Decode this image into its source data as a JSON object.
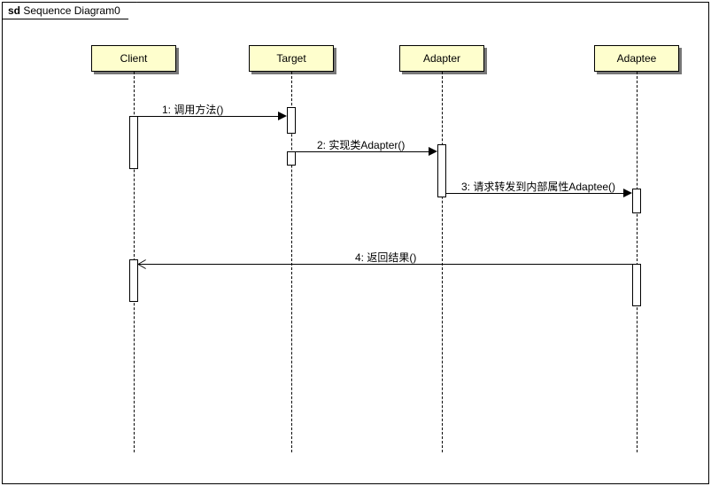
{
  "frame": {
    "prefix": "sd",
    "title": "Sequence Diagram0"
  },
  "participants": {
    "client": "Client",
    "target": "Target",
    "adapter": "Adapter",
    "adaptee": "Adaptee"
  },
  "messages": {
    "m1": "1: 调用方法()",
    "m2": "2: 实现类Adapter()",
    "m3": "3: 请求转发到内部属性Adaptee()",
    "m4": "4: 返回结果()"
  },
  "chart_data": {
    "type": "sequence-diagram",
    "title": "Sequence Diagram0",
    "participants": [
      "Client",
      "Target",
      "Adapter",
      "Adaptee"
    ],
    "messages": [
      {
        "seq": 1,
        "from": "Client",
        "to": "Target",
        "label": "调用方法()",
        "kind": "sync"
      },
      {
        "seq": 2,
        "from": "Target",
        "to": "Adapter",
        "label": "实现类Adapter()",
        "kind": "sync"
      },
      {
        "seq": 3,
        "from": "Adapter",
        "to": "Adaptee",
        "label": "请求转发到内部属性Adaptee()",
        "kind": "sync"
      },
      {
        "seq": 4,
        "from": "Adaptee",
        "to": "Client",
        "label": "返回结果()",
        "kind": "return"
      }
    ]
  }
}
